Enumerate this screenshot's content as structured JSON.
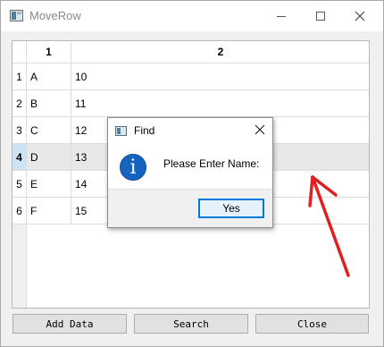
{
  "window": {
    "title": "MoveRow"
  },
  "table": {
    "columns": [
      "1",
      "2"
    ],
    "rows": [
      {
        "header": "1",
        "cells": [
          "A",
          "10"
        ]
      },
      {
        "header": "2",
        "cells": [
          "B",
          "11"
        ]
      },
      {
        "header": "3",
        "cells": [
          "C",
          "12"
        ]
      },
      {
        "header": "4",
        "cells": [
          "D",
          "13"
        ]
      },
      {
        "header": "5",
        "cells": [
          "E",
          "14"
        ]
      },
      {
        "header": "6",
        "cells": [
          "F",
          "15"
        ]
      }
    ],
    "current_row": "4"
  },
  "buttons": {
    "add": "Add Data",
    "search": "Search",
    "close": "Close"
  },
  "dialog": {
    "title": "Find",
    "message": "Please Enter Name:",
    "yes_label": "Yes",
    "icon": "info-icon"
  },
  "colors": {
    "accent": "#0078d7",
    "annotation": "#e02020",
    "info": "#1565c0"
  }
}
